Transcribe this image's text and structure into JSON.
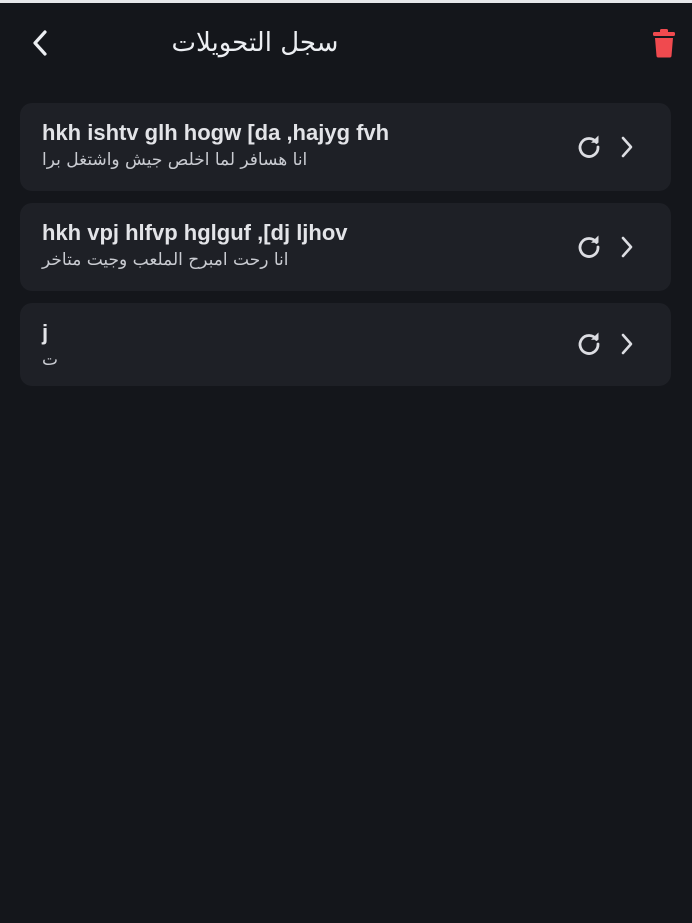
{
  "header": {
    "title": "سجل التحويلات",
    "back_icon": "chevron-left-icon",
    "delete_icon": "trash-icon",
    "delete_color": "#f04a4f"
  },
  "history": [
    {
      "input": "hkh ishtv glh hogw [da ,hajyg fvh",
      "output": "انا هسافر لما اخلص جيش واشتغل برا",
      "action_icon": "refresh-icon",
      "open_icon": "chevron-right-icon"
    },
    {
      "input": "hkh vpj hlfvp hglguf ,[dj ljhov",
      "output": "انا رحت امبرح الملعب وجيت متاخر",
      "action_icon": "refresh-icon",
      "open_icon": "chevron-right-icon"
    },
    {
      "input": "j",
      "output": "ت",
      "action_icon": "refresh-icon",
      "open_icon": "chevron-right-icon"
    }
  ],
  "colors": {
    "background": "#14161b",
    "card": "#1e2026",
    "text": "#e3e4e8",
    "accent_delete": "#f04a4f"
  }
}
